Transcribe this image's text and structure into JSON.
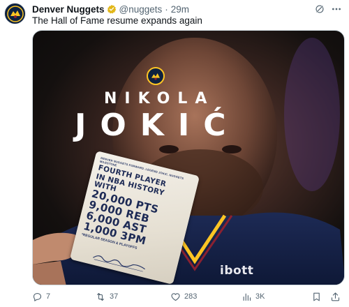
{
  "tweet": {
    "author_name": "Denver Nuggets",
    "handle": "@nuggets",
    "separator": "·",
    "time": "29m",
    "text": "The Hall of Fame resume expands again"
  },
  "media": {
    "first_name": "NIKOLA",
    "last_name": "JOKIĆ",
    "card": {
      "small_text": "DENVER NUGGETS FORWARD. LEGEND JOKIC. NUGGETS MILESTONE",
      "headline": [
        "FOURTH PLAYER",
        "IN NBA HISTORY WITH"
      ],
      "stats": [
        "20,000 PTS",
        "9,000 REB",
        "6,000 AST",
        "1,000 3PM"
      ],
      "note": "*REGULAR SEASON & PLAYOFFS"
    },
    "sponsor": "ibott"
  },
  "actions": {
    "replies": "7",
    "retweets": "37",
    "likes": "283",
    "views": "3K"
  },
  "colors": {
    "nuggets_navy": "#0e2240",
    "nuggets_gold": "#fec524",
    "verified_gold": "#e2b719",
    "secondary_text": "#536471"
  }
}
